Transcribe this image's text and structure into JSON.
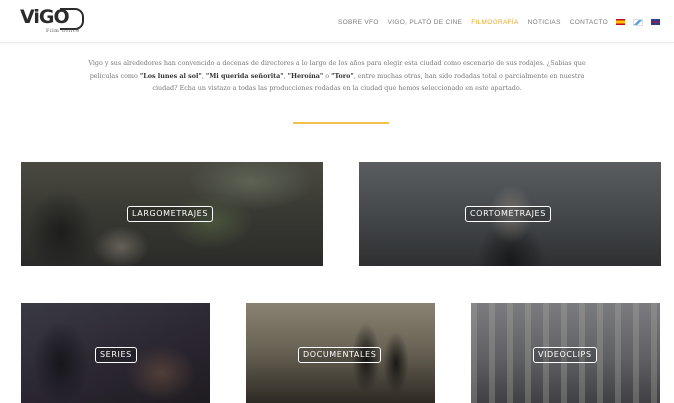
{
  "logo": {
    "main": "ViGO",
    "sub": "Film Office"
  },
  "nav": {
    "items": [
      {
        "label": "SOBRE VFO",
        "active": false
      },
      {
        "label": "VIGO, PLATÓ DE CINE",
        "active": false
      },
      {
        "label": "FILMOGRAFÍA",
        "active": true
      },
      {
        "label": "NOTICIAS",
        "active": false
      },
      {
        "label": "CONTACTO",
        "active": false
      }
    ],
    "flags": [
      "spanish-flag",
      "galician-flag",
      "uk-flag"
    ],
    "active_color": "#e6a82b"
  },
  "intro": {
    "part1": "Vigo y sus alrededores han convencido a decenas de directores a lo largo de los años para elegir esta ciudad como escenario de sus rodajes. ¿Sabías que películas como ",
    "film1": "\"Los lunes al sol\"",
    "sep1": ", ",
    "film2": "\"Mi querida señorita\"",
    "sep2": ", ",
    "film3": "\"Heroína\"",
    "sep3": " o ",
    "film4": "\"Toro\"",
    "part2": ", entre muchas otras, han sido rodadas total o parcialmente en nuestra ciudad? Echa un vistazo a todas las producciones rodadas en la ciudad que hemos seleccionado en este apartado."
  },
  "divider_color": "#f2c14e",
  "categories": [
    {
      "label": "LARGOMETRAJES"
    },
    {
      "label": "CORTOMETRAJES"
    },
    {
      "label": "SERIES"
    },
    {
      "label": "DOCUMENTALES"
    },
    {
      "label": "VIDEOCLIPS"
    }
  ]
}
